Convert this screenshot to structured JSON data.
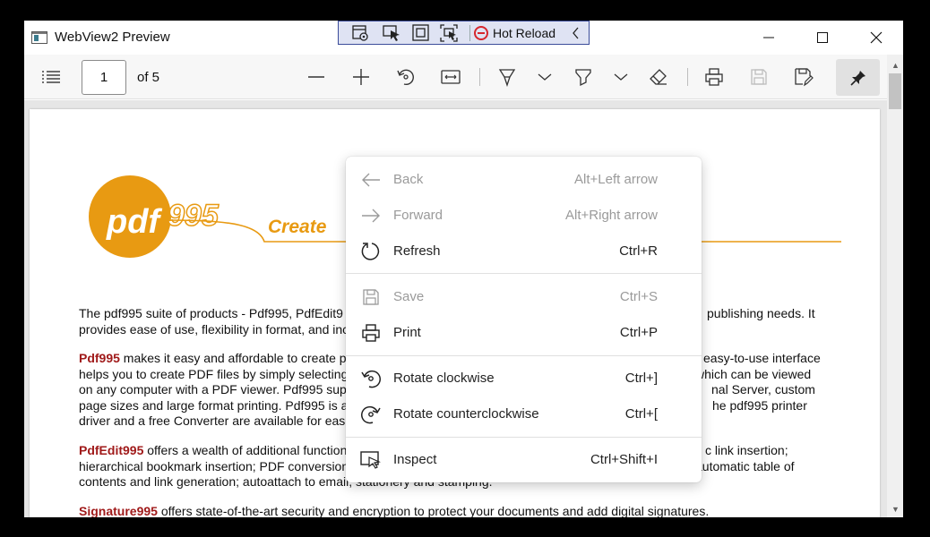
{
  "window": {
    "title": "WebView2 Preview"
  },
  "hot_reload": {
    "label": "Hot Reload"
  },
  "pdf_toolbar": {
    "page_number": "1",
    "page_total": "of 5"
  },
  "document": {
    "logo_text": "pdf995",
    "tagline": "Create",
    "para1": "The pdf995 suite of products - Pdf995, PdfEdit995, ... publishing needs. It provides ease of use, flexibility in format, and ind...",
    "para2_brand": "Pdf995",
    "para2_lines": [
      " makes it easy and affordable to create p",
      "helps you to create PDF files by simply selecting",
      "on any computer with a PDF viewer. Pdf995 sup",
      "page sizes and large format printing. Pdf995 is a",
      "driver and a free Converter are available for eas"
    ],
    "para2_right": [
      "easy-to-use interface",
      "which can be viewed",
      "nal Server, custom",
      "he pdf995 printer",
      ""
    ],
    "para3_brand": "PdfEdit995",
    "para3_lines": [
      " offers a wealth of additional function",
      "hierarchical bookmark insertion; PDF conversion",
      "contents and link generation; autoattach to emai"
    ],
    "para3_right": [
      "c link insertion;",
      "automatic table of",
      ""
    ],
    "para3_tail": "l, stationery and stamping.",
    "para4_brand": "Signature995",
    "para4_text": " offers state-of-the-art security and encryption to protect your documents and add digital signatures.",
    "p1_line1_left": "The pdf995 suite of products - Pdf995, PdfEdit9",
    "p1_line1_right": "publishing needs. It",
    "p1_line2_left": "provides ease of use, flexibility in format, and inc"
  },
  "context_menu": {
    "items": [
      {
        "label": "Back",
        "shortcut": "Alt+Left arrow",
        "icon": "arrow-left-icon",
        "disabled": true
      },
      {
        "label": "Forward",
        "shortcut": "Alt+Right arrow",
        "icon": "arrow-right-icon",
        "disabled": true
      },
      {
        "label": "Refresh",
        "shortcut": "Ctrl+R",
        "icon": "refresh-icon",
        "disabled": false
      },
      {
        "label": "Save",
        "shortcut": "Ctrl+S",
        "icon": "save-icon",
        "disabled": true
      },
      {
        "label": "Print",
        "shortcut": "Ctrl+P",
        "icon": "printer-icon",
        "disabled": false
      },
      {
        "label": "Rotate clockwise",
        "shortcut": "Ctrl+]",
        "icon": "rotate-clockwise-icon",
        "disabled": false
      },
      {
        "label": "Rotate counterclockwise",
        "shortcut": "Ctrl+[",
        "icon": "rotate-counterclockwise-icon",
        "disabled": false
      },
      {
        "label": "Inspect",
        "shortcut": "Ctrl+Shift+I",
        "icon": "inspect-icon",
        "disabled": false
      }
    ]
  },
  "colors": {
    "logo_orange": "#e89a12",
    "brand_red": "#a01a1a",
    "stop_red": "#d6262d"
  }
}
